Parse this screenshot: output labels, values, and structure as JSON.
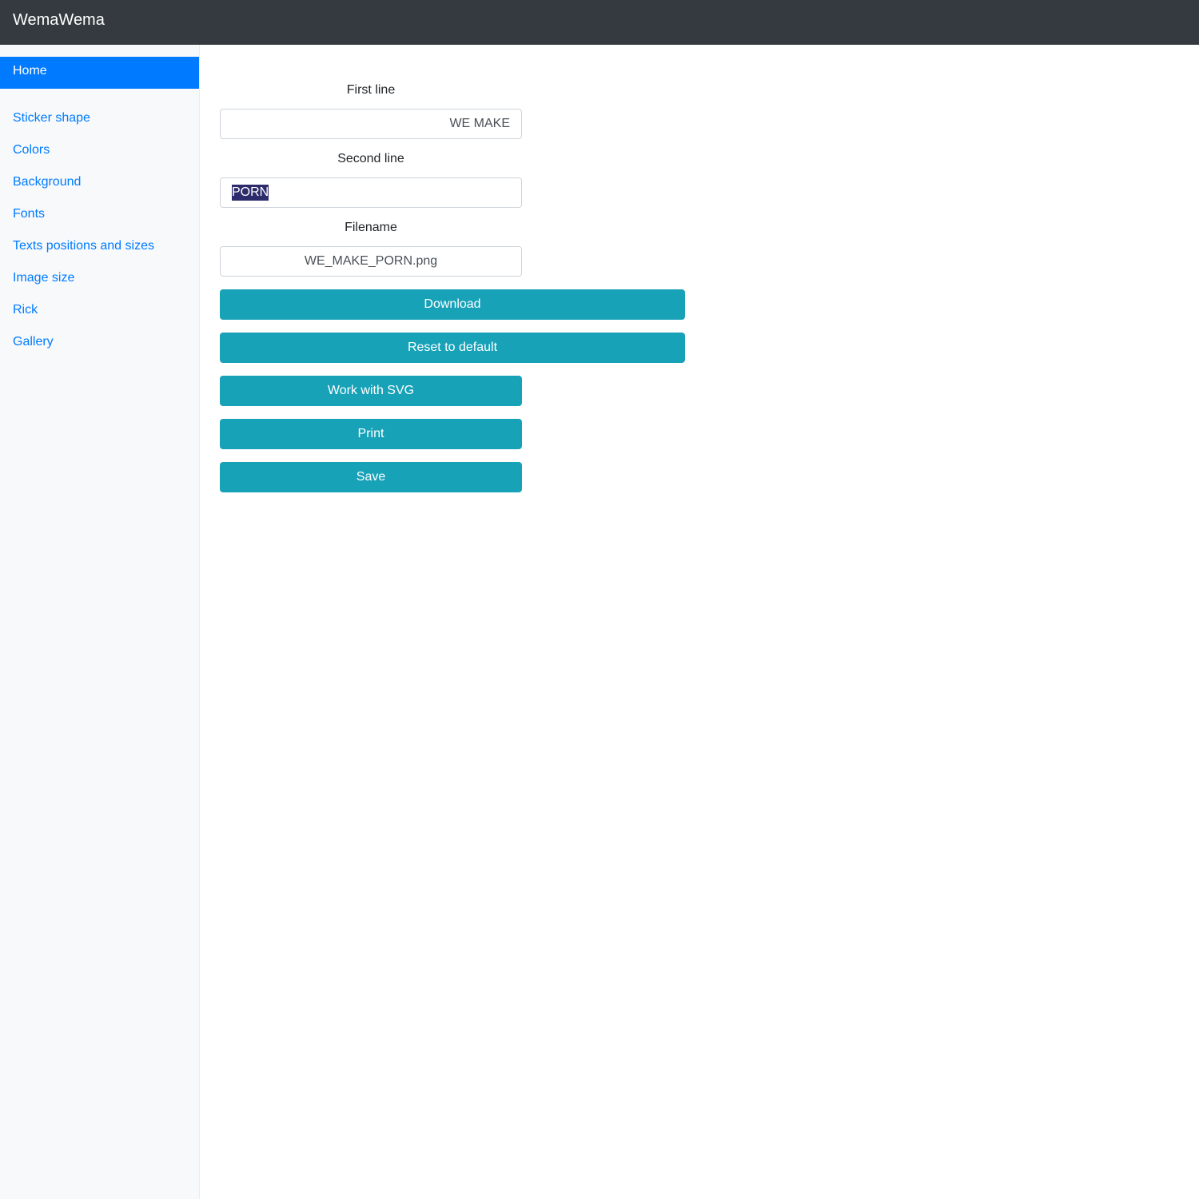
{
  "navbar": {
    "brand": "WemaWema"
  },
  "sidebar": {
    "active": "Home",
    "items": [
      {
        "label": "Sticker shape"
      },
      {
        "label": "Colors"
      },
      {
        "label": "Background"
      },
      {
        "label": "Fonts"
      },
      {
        "label": "Texts positions and sizes"
      },
      {
        "label": "Image size"
      },
      {
        "label": "Rick"
      },
      {
        "label": "Gallery"
      }
    ]
  },
  "form": {
    "first_line": {
      "label": "First line",
      "value": "WE MAKE"
    },
    "second_line": {
      "label": "Second line",
      "value": "PORN"
    },
    "filename": {
      "label": "Filename",
      "value": "WE_MAKE_PORN.png"
    }
  },
  "buttons": {
    "download": "Download",
    "reset": "Reset to default",
    "svg": "Work with SVG",
    "print": "Print",
    "save": "Save"
  },
  "colors": {
    "navbar": "#343a40",
    "active": "#007bff",
    "link": "#007bff",
    "button": "#17a2b8"
  }
}
